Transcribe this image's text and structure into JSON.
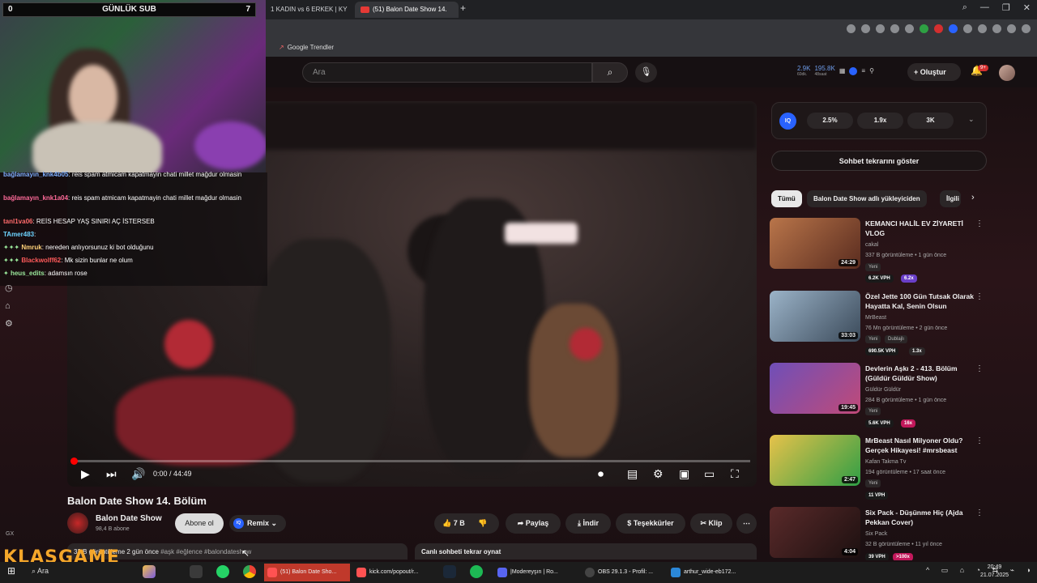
{
  "browser": {
    "tabs": [
      {
        "label": "1 KADIN vs 6 ERKEK | KY"
      },
      {
        "label": "(51) Balon Date Show 14."
      }
    ],
    "bookmark": "Google Trendler"
  },
  "header": {
    "search_placeholder": "Ara",
    "stats": {
      "a_value": "2.9K",
      "a_sub": "60dk.",
      "b_value": "195.8K",
      "b_sub": "48saat"
    },
    "create_label": "Oluştur",
    "notif_count": "9+"
  },
  "player": {
    "time": "0:00 / 44:49",
    "title": "Balon Date Show 14. Bölüm",
    "progress": 0
  },
  "channel": {
    "name": "Balon Date Show",
    "subs": "98,4 B abone",
    "subscribe_label": "Abone ol",
    "remix_label": "Remix"
  },
  "actions": {
    "likes": "7 B",
    "share": "Paylaş",
    "download": "İndir",
    "thanks": "Teşekkürler",
    "clip": "Klip"
  },
  "description": {
    "text": "32 B görüntüleme  2 gün önce",
    "tags": "#aşk #eğlence #balondateshow",
    "replay": "Canlı sohbeti tekrar oynat"
  },
  "sidebar": {
    "iq_label": "IQ",
    "iq_values": [
      "2.5%",
      "1.9x",
      "3K"
    ],
    "show_chat": "Sohbet tekrarını göster",
    "chips": [
      "Tümü",
      "Balon Date Show adlı yükleyiciden",
      "İlgili"
    ],
    "recommendations": [
      {
        "title": "KEMANCI HALİL EV ZİYARETİ VLOG",
        "channel": "cakal",
        "meta": "337 B görüntüleme • 1 gün önce",
        "badges": [
          "Yeni"
        ],
        "duration": "24:29",
        "vph": "6.2K VPH",
        "mult": "6.2x"
      },
      {
        "title": "Özel Jette 100 Gün Tutsak Olarak Hayatta Kal, Senin Olsun",
        "channel": "MrBeast",
        "meta": "76 Mn görüntüleme • 2 gün önce",
        "badges": [
          "Yeni",
          "Dublajlı"
        ],
        "duration": "33:03",
        "vph": "690.5K VPH",
        "mult": "1.3x"
      },
      {
        "title": "Devlerin Aşkı 2 - 413. Bölüm (Güldür Güldür Show)",
        "channel": "Güldür Güldür",
        "meta": "284 B görüntüleme • 1 gün önce",
        "badges": [
          "Yeni"
        ],
        "duration": "19:45",
        "vph": "5.6K VPH",
        "mult": "16x"
      },
      {
        "title": "MrBeast Nasıl Milyoner Oldu? Gerçek Hikayesi! #mrsbeast",
        "channel": "Kafan Takma Tv",
        "meta": "194 görüntüleme • 17 saat önce",
        "badges": [
          "Yeni"
        ],
        "duration": "2:47",
        "vph": "11 VPH",
        "mult": ""
      },
      {
        "title": "Six Pack - Düşünme Hiç (Ajda Pekkan Cover)",
        "channel": "Six Pack",
        "meta": "32 B görüntüleme • 11 yıl önce",
        "badges": [],
        "duration": "4:04",
        "vph": "39 VPH",
        "mult": ">100x"
      }
    ]
  },
  "overlay": {
    "sub_counter_left": "0",
    "sub_counter_title": "GÜNLÜK SUB",
    "sub_counter_right": "7",
    "chat": [
      {
        "user": "bağlamayın_knk4b05",
        "msg": ": reis spam atmicam kapatmayin chati millet mağdur olmasin",
        "color": "#7fb0ff"
      },
      {
        "user": "bağlamayın_knk1a04",
        "msg": ": reis spam atmicam kapatmayin chati millet mağdur olmasin",
        "color": "#ff6b9a"
      },
      {
        "user": "tanl1va06",
        "msg": ": REİS HESAP YAŞ SINIRI AÇ İSTERSEB",
        "color": "#ff6b6b"
      },
      {
        "user": "TAmer483",
        "msg": ":",
        "color": "#6dd3ff"
      },
      {
        "user": "Nmruk",
        "msg": ": nereden anlıyorsunuz ki bot olduğunu",
        "color": "#ffd27a"
      },
      {
        "user": "Blackwolff62",
        "msg": ": Mk sizin bunlar ne olum",
        "color": "#ff5a5a"
      },
      {
        "user": "heus_edits",
        "msg": ": adamsın rose",
        "color": "#9be89b"
      }
    ],
    "gx": "GX",
    "brand": "KLASGAME"
  },
  "taskbar": {
    "search": "Ara",
    "apps": [
      {
        "label": "(51) Balon Date Sho..."
      },
      {
        "label": "kick.com/popout/r..."
      },
      {
        "label": "|Modereyşın | Ro..."
      },
      {
        "label": "OBS 29.1.3 - Profil: ..."
      },
      {
        "label": "arthur_wide-eb172..."
      }
    ],
    "time": "20:49",
    "date": "21.07.2025"
  }
}
